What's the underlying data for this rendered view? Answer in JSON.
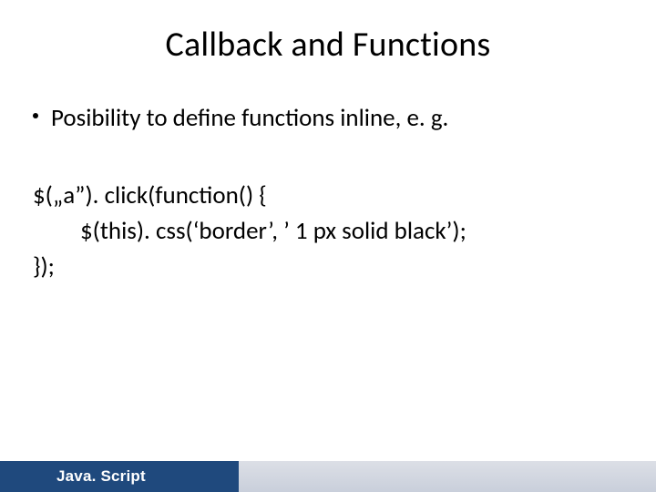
{
  "title": "Callback and Functions",
  "bullet": "Posibility to define functions inline, e. g.",
  "code": {
    "line1": "$(„a”). click(function() {",
    "line2": "$(this). css(‘border’, ’ 1 px solid black’);",
    "line3": "});"
  },
  "footer": {
    "label": "Java. Script"
  }
}
